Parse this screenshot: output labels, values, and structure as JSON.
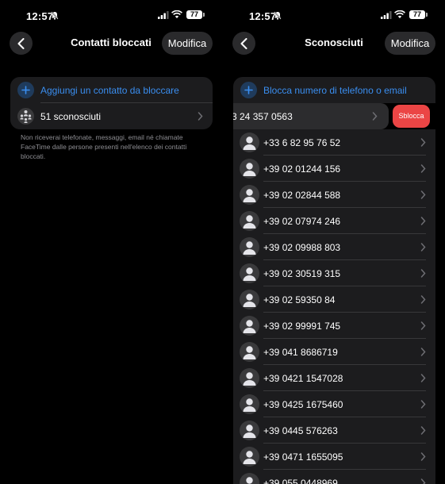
{
  "left": {
    "status": {
      "time": "12:57",
      "battery": "77"
    },
    "nav": {
      "title": "Contatti bloccati",
      "edit_label": "Modifica"
    },
    "add_contact_label": "Aggiungi un contatto da bloccare",
    "unknown_label": "51 sconosciuti",
    "footnote": "Non riceverai telefonate, messaggi, email né chiamate FaceTime dalle persone presenti nell'elenco dei contatti bloccati."
  },
  "right": {
    "status": {
      "time": "12:57",
      "battery": "77"
    },
    "nav": {
      "title": "Sconosciuti",
      "edit_label": "Modifica"
    },
    "block_number_label": "Blocca numero di telefono o email",
    "swiped_number": "3 24 357 0563",
    "unblock_label": "Sblocca",
    "numbers": [
      "+33 6 82 95 76 52",
      "+39 02 01244 156",
      "+39 02 02844 588",
      "+39 02 07974 246",
      "+39 02 09988 803",
      "+39 02 30519 315",
      "+39 02 59350 84",
      "+39 02 99991 745",
      "+39 041 8686719",
      "+39 0421 1547028",
      "+39 0425 1675460",
      "+39 0445 576263",
      "+39 0471 1655095",
      "+39 055 0448969"
    ]
  },
  "colors": {
    "accent": "#3a8ef0",
    "destructive": "#eb4545",
    "card": "#1c1c1e"
  }
}
